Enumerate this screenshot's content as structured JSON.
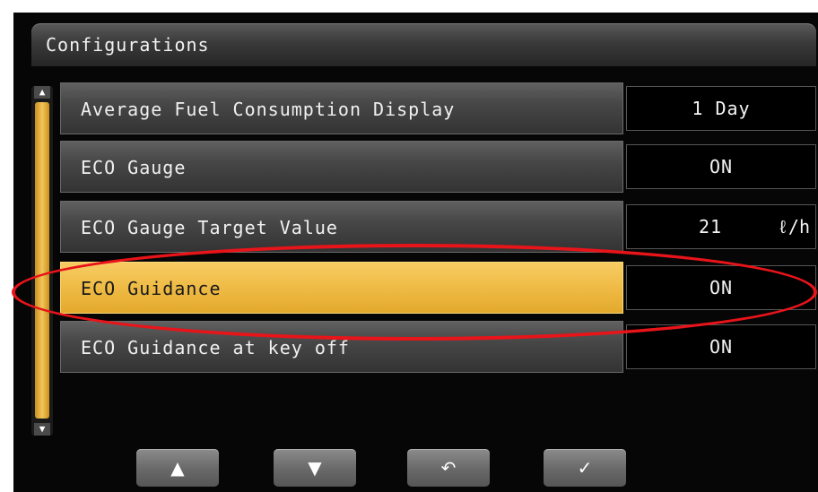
{
  "header": {
    "title": "Configurations"
  },
  "scrollbar": {
    "up_icon": "triangle-up",
    "down_icon": "triangle-down"
  },
  "rows": [
    {
      "label": "Average Fuel Consumption Display",
      "value": "1 Day",
      "unit": "",
      "selected": false
    },
    {
      "label": "ECO Gauge",
      "value": "ON",
      "unit": "",
      "selected": false
    },
    {
      "label": "ECO Gauge Target Value",
      "value": "21",
      "unit": "ℓ/h",
      "selected": false
    },
    {
      "label": "ECO Guidance",
      "value": "ON",
      "unit": "",
      "selected": true
    },
    {
      "label": "ECO Guidance at key off",
      "value": "ON",
      "unit": "",
      "selected": false
    }
  ],
  "bottom_bar": {
    "buttons": [
      {
        "name": "up-button",
        "icon": "▲"
      },
      {
        "name": "down-button",
        "icon": "▼"
      },
      {
        "name": "back-button",
        "icon": "↶"
      },
      {
        "name": "confirm-button",
        "icon": "✓"
      }
    ]
  },
  "colors": {
    "selected_row": "#efbb45",
    "highlight_annotation": "#e8141a",
    "background": "#060606"
  }
}
